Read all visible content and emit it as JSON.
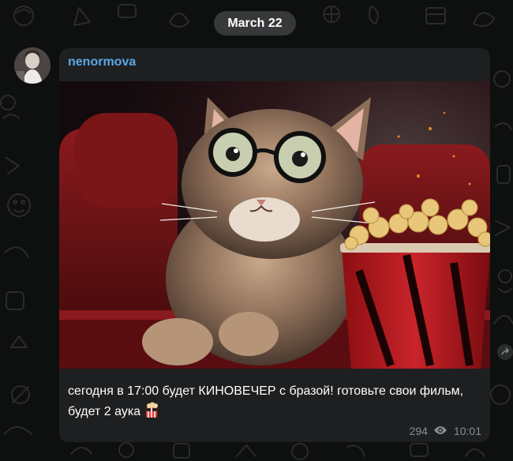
{
  "chat": {
    "date_separator": "March 22"
  },
  "message": {
    "sender_name": "nenormova",
    "photo_subject": "kitten-with-glasses-in-cinema-with-popcorn",
    "text": "сегодня в 17:00 будет КИНОВЕЧЕР с бразой! готовьте свои фильм, будет 2 аука",
    "emoji": "popcorn-glasses-emoji",
    "views": "294",
    "time": "10:01"
  },
  "colors": {
    "background": "#0e0f0f",
    "bubble": "#1e1f20",
    "sender_name": "#5aa7e6",
    "meta_text": "#8a8e92"
  }
}
